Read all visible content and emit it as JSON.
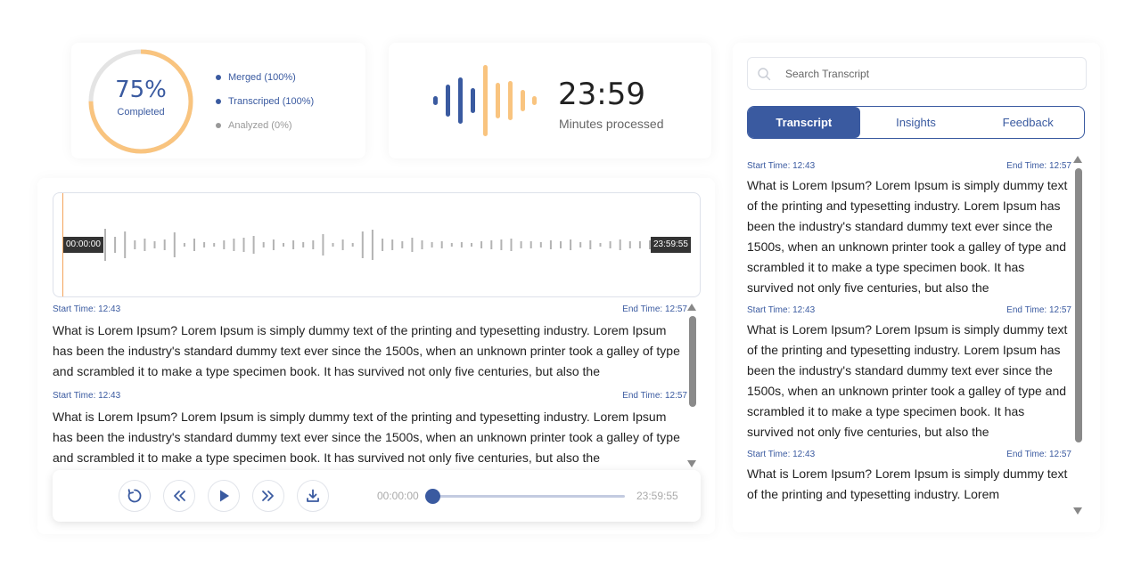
{
  "colors": {
    "accent": "#3a5aa0",
    "orange": "#f9c47f",
    "muted": "#999999"
  },
  "progress": {
    "percent_label": "75%",
    "percent_value": 0.75,
    "caption": "Completed",
    "legend": [
      {
        "label": "Merged (100%)",
        "color": "#3a5aa0"
      },
      {
        "label": "Transcriped (100%)",
        "color": "#3a5aa0"
      },
      {
        "label": "Analyzed (0%)",
        "color": "#999999"
      }
    ]
  },
  "minutes": {
    "value": "23:59",
    "label": "Minutes processed"
  },
  "player": {
    "start_time_tag": "00:00:00",
    "end_time_tag": "23:59:55",
    "current_time": "00:00:00",
    "total_time": "23:59:55",
    "progress": 0.0
  },
  "segments": [
    {
      "start": "Start Time: 12:43",
      "end": "End Time: 12:57",
      "text": "What is Lorem Ipsum? Lorem Ipsum is simply dummy text of the printing and typesetting industry. Lorem Ipsum has been the industry's standard dummy text ever since the 1500s, when an unknown printer took a galley of type and scrambled it to make a type specimen book. It has survived not only five centuries, but also the"
    },
    {
      "start": "Start Time: 12:43",
      "end": "End Time: 12:57",
      "text": "What is Lorem Ipsum? Lorem Ipsum is simply dummy text of the printing and typesetting industry. Lorem Ipsum has been the industry's standard dummy text ever since the 1500s, when an unknown printer took a galley of type and scrambled it to make a type specimen book. It has survived not only five centuries, but also the"
    }
  ],
  "right_panel": {
    "search_placeholder": "Search Transcript",
    "tabs": [
      "Transcript",
      "Insights",
      "Feedback"
    ],
    "active_tab": "Transcript",
    "segments": [
      {
        "start": "Start Time: 12:43",
        "end": "End Time: 12:57",
        "text": "What is Lorem Ipsum? Lorem Ipsum is simply dummy text of the printing and typesetting industry. Lorem Ipsum has been the industry's standard dummy text ever since the 1500s, when an unknown printer took a galley of type and scrambled it to make a type specimen book. It has survived not only five centuries, but also the"
      },
      {
        "start": "Start Time: 12:43",
        "end": "End Time: 12:57",
        "text": "What is Lorem Ipsum? Lorem Ipsum is simply dummy text of the printing and typesetting industry. Lorem Ipsum has been the industry's standard dummy text ever since the 1500s, when an unknown printer took a galley of type and scrambled it to make a type specimen book. It has survived not only five centuries, but also the"
      },
      {
        "start": "Start Time: 12:43",
        "end": "End Time: 12:57",
        "text": "What is Lorem Ipsum? Lorem Ipsum is simply dummy text of the printing and typesetting industry. Lorem"
      }
    ]
  },
  "icons": {
    "replay": "replay-icon",
    "rewind": "rewind-icon",
    "play": "play-icon",
    "forward": "fast-forward-icon",
    "download": "download-icon",
    "search": "search-icon"
  }
}
